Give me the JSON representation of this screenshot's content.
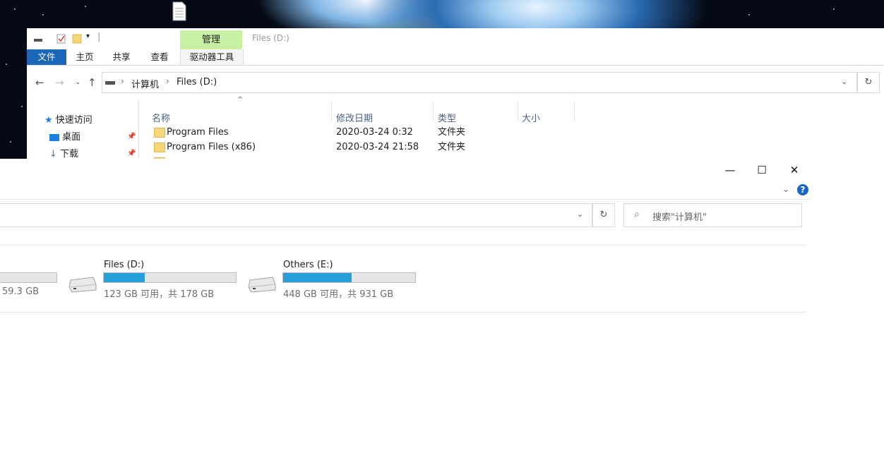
{
  "back_window": {
    "title": "Files (D:)",
    "manage_tab": "管理",
    "ribbon_tabs": [
      "文件",
      "主页",
      "共享",
      "查看",
      "驱动器工具"
    ],
    "breadcrumb": [
      "计算机",
      "Files (D:)"
    ],
    "nav_items": [
      {
        "label": "快速访问",
        "icon": "star-icon"
      },
      {
        "label": "桌面",
        "icon": "desktop-icon"
      },
      {
        "label": "下载",
        "icon": "download-icon"
      }
    ],
    "columns": [
      "名称",
      "修改日期",
      "类型",
      "大小"
    ],
    "files": [
      {
        "name": "Program Files",
        "date": "2020-03-24 0:32",
        "type": "文件夹"
      },
      {
        "name": "Program Files (x86)",
        "date": "2020-03-24 21:58",
        "type": "文件夹"
      }
    ]
  },
  "front_window": {
    "controls": {
      "minimize": "—",
      "maximize": "☐",
      "close": "✕"
    },
    "help": "?",
    "search_placeholder": "搜索\"计算机\"",
    "drives": [
      {
        "name": "",
        "space": "59.3 GB",
        "used_fraction": 0.0
      },
      {
        "name": "Files (D:)",
        "space": "123 GB 可用，共 178 GB",
        "used_fraction": 0.31
      },
      {
        "name": "Others (E:)",
        "space": "448 GB 可用，共 931 GB",
        "used_fraction": 0.52
      }
    ]
  },
  "colors": {
    "accent": "#1a66b7",
    "bar_fill": "#26a0da",
    "manage_tab": "#c7f0a4"
  }
}
